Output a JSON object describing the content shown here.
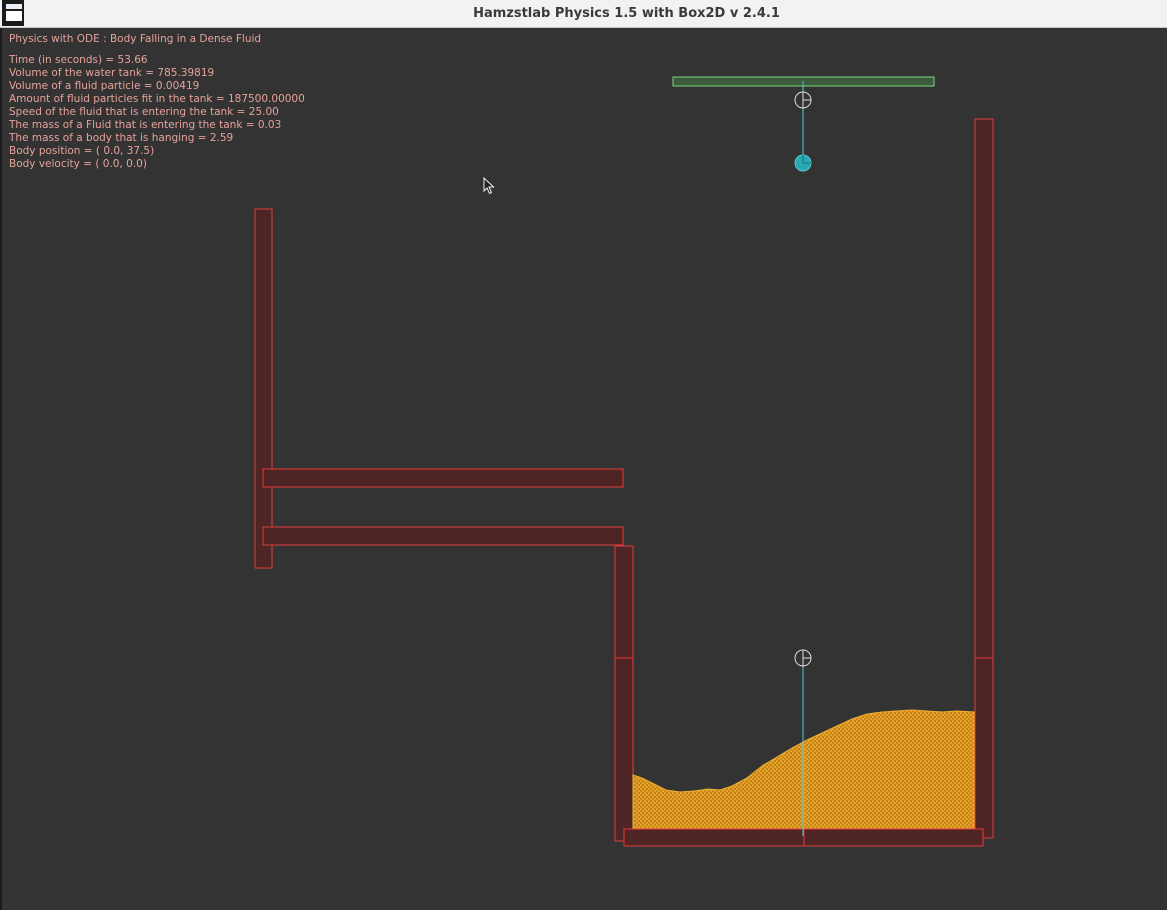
{
  "window": {
    "title": "Hamzstlab Physics 1.5 with Box2D v 2.4.1"
  },
  "hud": {
    "title": "Physics with ODE : Body Falling in a Dense Fluid",
    "lines": [
      "Time (in seconds) = 53.66",
      "Volume of the water tank = 785.39819",
      "Volume of a fluid particle = 0.00419",
      "Amount of fluid particles fit in the tank = 187500.00000",
      "Speed of the fluid that is entering the tank = 25.00",
      "The mass of a Fluid that is entering the tank = 0.03",
      "The mass of a body that is hanging = 2.59",
      "Body position = ( 0.0, 37.5)",
      "Body velocity = ( 0.0,  0.0)"
    ]
  },
  "colors": {
    "background": "#333333",
    "wall_fill": "#4f2424",
    "wall_stroke": "#e03c3c",
    "fluid": "#e8a224",
    "fluid_dark": "#8a5a14",
    "ceiling_fill": "#3c5a3c",
    "ceiling_stroke": "#7ed87e",
    "joint": "#dddddd",
    "rope": "#56c7d0",
    "body": "#27a9b2",
    "hud_text": "#e6a29a"
  },
  "icons": {
    "app": "app-window-icon",
    "cursor": "mouse-pointer-icon",
    "pivot": "revolute-joint-icon"
  }
}
